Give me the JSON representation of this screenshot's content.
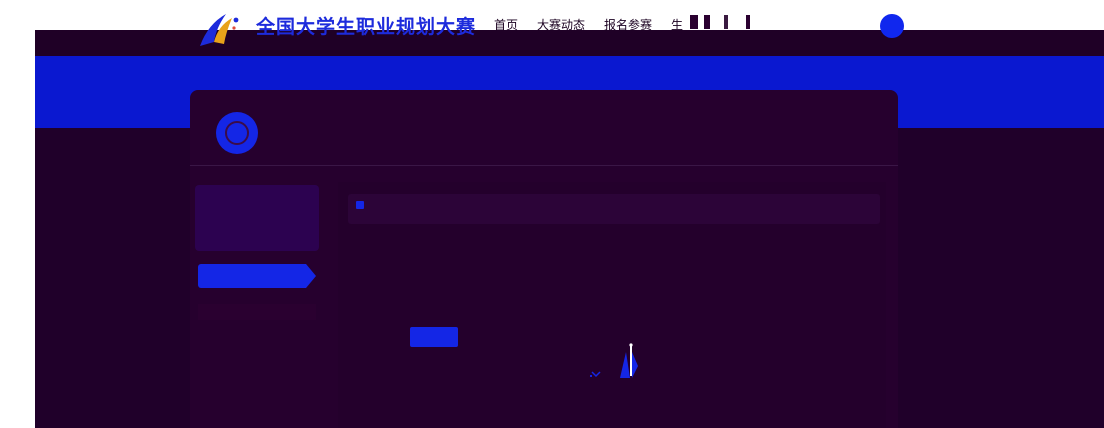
{
  "brand": {
    "title": "全国大学生职业规划大赛"
  },
  "nav": {
    "items": [
      {
        "label": "首页"
      },
      {
        "label": "大赛动态"
      },
      {
        "label": "报名参赛"
      },
      {
        "label": "生"
      }
    ]
  },
  "side": {
    "button_label": " "
  },
  "content": {
    "notice_text": "",
    "action_label": ""
  },
  "colors": {
    "brand_blue": "#1426e6",
    "banner_blue": "#0a18d0",
    "background": "#20002a"
  },
  "icons": {
    "logo": "competition-logo-icon",
    "avatar": "user-avatar-icon",
    "notice": "info-icon",
    "empty": "empty-state-illustration"
  }
}
